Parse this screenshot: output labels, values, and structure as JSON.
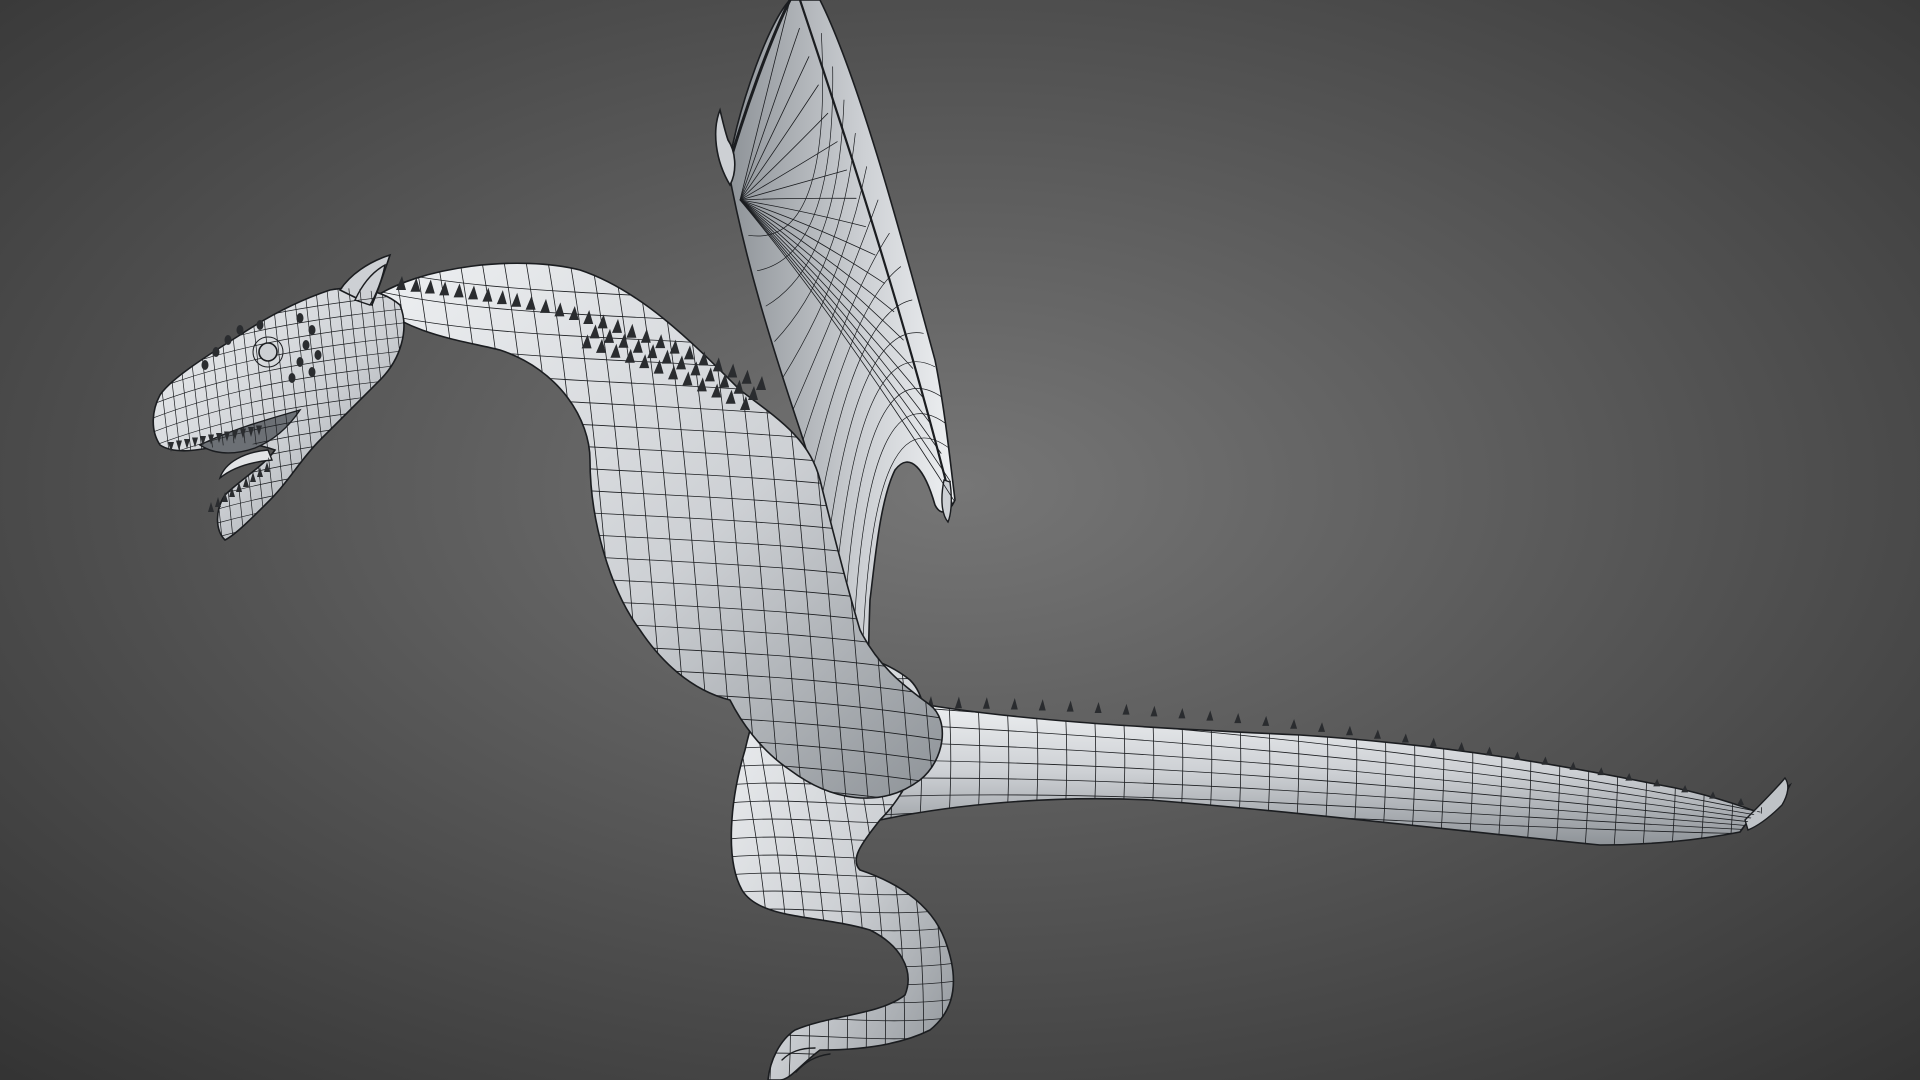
{
  "viewport": {
    "background": {
      "center": "#767676",
      "edge": "#333333"
    },
    "model": {
      "subject": "dragon",
      "display_mode": "wireframe-on-shaded",
      "surface_color": "#cdd0d4",
      "surface_shadow": "#8e9398",
      "surface_highlight": "#eef0f2",
      "wire_color": "#1b1d20",
      "spike_color": "#2a2c2f"
    }
  }
}
